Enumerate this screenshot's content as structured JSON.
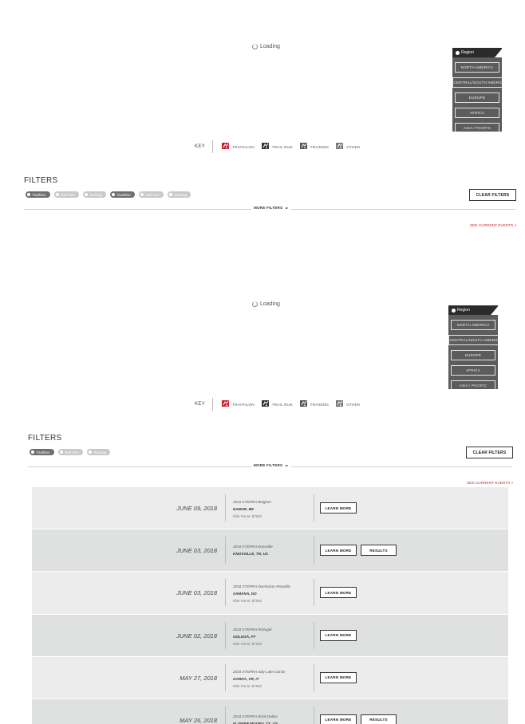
{
  "sections": [
    {
      "loading_text": "Loading",
      "region": {
        "header": "Region",
        "items": [
          "NORTH AMERICA",
          "CENTRAL/SOUTH AMERICA",
          "EUROPE",
          "AFRICA",
          "ASIA / PACIFIC"
        ]
      },
      "key": {
        "label": "KEY",
        "items": [
          {
            "label": "TRIATHLON",
            "icon": "triathlon-icon",
            "color": "#c8202f"
          },
          {
            "label": "TRAIL RUN",
            "icon": "trail-run-icon",
            "color": "#333333"
          },
          {
            "label": "TRAINING",
            "icon": "training-icon",
            "color": "#555555"
          },
          {
            "label": "OTHER",
            "icon": "other-icon",
            "color": "#777777"
          }
        ]
      },
      "filters": {
        "title": "FILTERS",
        "pills": [
          {
            "label": "Triathlon",
            "active": true
          },
          {
            "label": "Trail Run",
            "active": false
          },
          {
            "label": "Training",
            "active": false
          },
          {
            "label": "Triathlon",
            "active": true
          },
          {
            "label": "Trail Run",
            "active": false
          },
          {
            "label": "Training",
            "active": false
          }
        ],
        "clear_label": "CLEAR FILTERS",
        "more_label": "MORE FILTERS",
        "see_current": "SEE CURRENT EVENTS >"
      }
    },
    {
      "loading_text": "Loading",
      "region": {
        "header": "Region",
        "items": [
          "NORTH AMERICA",
          "CENTRAL/SOUTH AMERICA",
          "EUROPE",
          "AFRICA",
          "ASIA / PACIFIC"
        ]
      },
      "key": {
        "label": "KEY",
        "items": [
          {
            "label": "TRIATHLON",
            "icon": "triathlon-icon",
            "color": "#c8202f"
          },
          {
            "label": "TRAIL RUN",
            "icon": "trail-run-icon",
            "color": "#333333"
          },
          {
            "label": "TRAINING",
            "icon": "training-icon",
            "color": "#555555"
          },
          {
            "label": "OTHER",
            "icon": "other-icon",
            "color": "#777777"
          }
        ]
      },
      "filters": {
        "title": "FILTERS",
        "pills": [
          {
            "label": "Triathlon",
            "active": true
          },
          {
            "label": "Trail Run",
            "active": false
          },
          {
            "label": "Training",
            "active": false
          }
        ],
        "clear_label": "CLEAR FILTERS",
        "more_label": "MORE FILTERS",
        "see_current": "SEE CURRENT EVENTS >"
      }
    }
  ],
  "events": [
    {
      "date": "JUNE 09, 2018",
      "name": "2018 XTERRA Belgium",
      "location": "NAMUR, BE",
      "purse": "Elite Purse: $7500",
      "learn_more": "LEARN MORE",
      "results": ""
    },
    {
      "date": "JUNE 03, 2018",
      "name": "2018 XTERRA Knoxville",
      "location": "KNOXVILLE, TN, US",
      "purse": "",
      "learn_more": "LEARN MORE",
      "results": "RESULTS"
    },
    {
      "date": "JUNE 03, 2018",
      "name": "2018 XTERRA Dominican Republic",
      "location": "SAMANA, DO",
      "purse": "Elite Purse: $7500",
      "learn_more": "LEARN MORE",
      "results": ""
    },
    {
      "date": "JUNE 02, 2018",
      "name": "2018 XTERRA Portugal",
      "location": "GOLEGÃ, PT",
      "purse": "Elite Purse: $7500",
      "learn_more": "LEARN MORE",
      "results": ""
    },
    {
      "date": "MAY 27, 2018",
      "name": "2018 XTERRA Italy Lake Garda",
      "location": "GARDA, VR, IT",
      "purse": "Elite Purse: $7500",
      "learn_more": "LEARN MORE",
      "results": ""
    },
    {
      "date": "MAY 26, 2018",
      "name": "2018 XTERRA Rock Dallas",
      "location": "FLOWER MOUND, TX, US",
      "purse": "",
      "learn_more": "LEARN MORE",
      "results": "RESULTS"
    }
  ]
}
